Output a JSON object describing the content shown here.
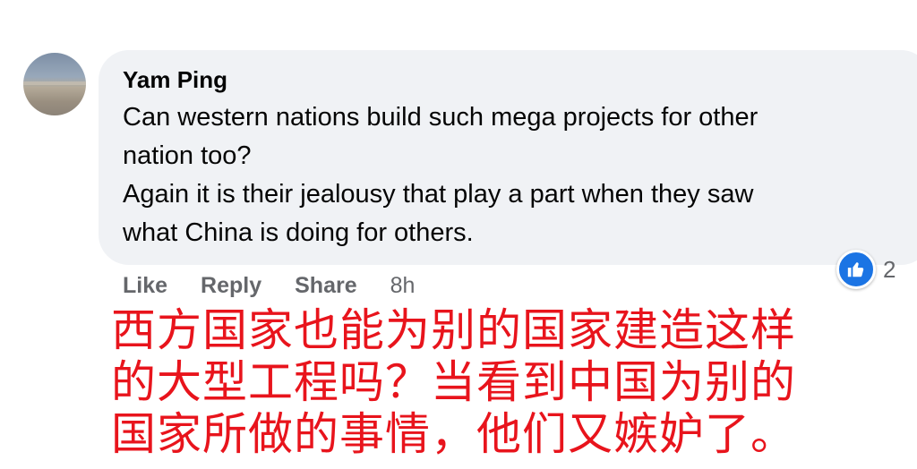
{
  "comment": {
    "author": "Yam Ping",
    "text_lines": [
      "Can western nations build such mega projects for other",
      "nation too?",
      "Again it is their jealousy that play a part when they saw",
      "what China is doing for others."
    ],
    "actions": {
      "like": "Like",
      "reply": "Reply",
      "share": "Share",
      "time": "8h"
    },
    "reaction": {
      "icon": "thumbs-up-icon",
      "count": "2",
      "color": "#1b74e4"
    }
  },
  "translation": {
    "color": "#e8141c",
    "lines": [
      "西方国家也能为别的国家建造这样",
      "的大型工程吗？当看到中国为别的",
      "国家所做的事情，他们又嫉妒了。"
    ]
  }
}
